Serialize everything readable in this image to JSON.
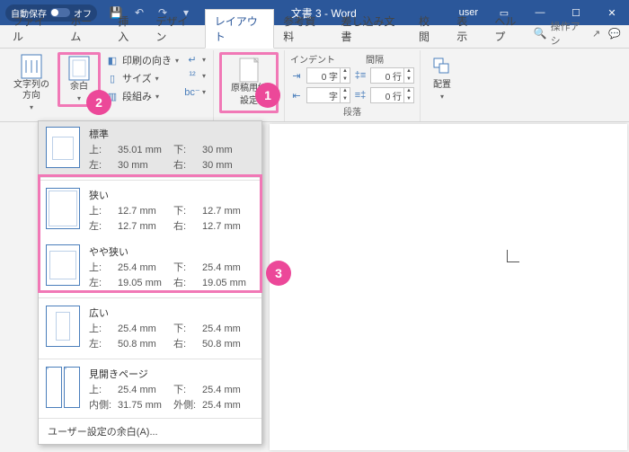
{
  "titlebar": {
    "autosave_label": "自動保存",
    "autosave_state": "オフ",
    "doc_title": "文書 3 - Word",
    "user": "user"
  },
  "tabs": {
    "items": [
      "ファイル",
      "ホーム",
      "挿入",
      "デザイン",
      "レイアウト",
      "参考資料",
      "差し込み文書",
      "校閲",
      "表示",
      "ヘルプ"
    ],
    "active_index": 4,
    "search_label": "操作アシ"
  },
  "ribbon": {
    "text_direction": {
      "label": "文字列の\n方向"
    },
    "margins": {
      "label": "余白"
    },
    "page_setup": {
      "orientation": "印刷の向き",
      "size": "サイズ",
      "columns": "段組み"
    },
    "breaks_group": {
      "items": [
        "区切り",
        "行番号",
        "ハイフネーション"
      ]
    },
    "genko": {
      "line1": "原稿用紙",
      "line2": "設定"
    },
    "indent": {
      "header_left": "インデント",
      "header_right": "間隔",
      "left_val": "0 字",
      "right_val": "0 行",
      "left_val2": "字",
      "right_val2": "0 行",
      "group_label": "段落"
    },
    "arrange": {
      "label": "配置"
    }
  },
  "callouts": {
    "c1": "1",
    "c2": "2",
    "c3": "3"
  },
  "dropdown": {
    "items": [
      {
        "title": "標準",
        "top": "35.01 mm",
        "bottom": "30 mm",
        "left": "30 mm",
        "right": "30 mm",
        "icon": "normal"
      },
      {
        "title": "狭い",
        "top": "12.7 mm",
        "bottom": "12.7 mm",
        "left": "12.7 mm",
        "right": "12.7 mm",
        "icon": "narrow"
      },
      {
        "title": "やや狭い",
        "top": "25.4 mm",
        "bottom": "25.4 mm",
        "left": "19.05 mm",
        "right": "19.05 mm",
        "icon": "moderate"
      },
      {
        "title": "広い",
        "top": "25.4 mm",
        "bottom": "25.4 mm",
        "left": "50.8 mm",
        "right": "50.8 mm",
        "icon": "wide"
      },
      {
        "title": "見開きページ",
        "top": "25.4 mm",
        "bottom": "25.4 mm",
        "left": "31.75 mm",
        "right": "25.4 mm",
        "icon": "mirror",
        "k3": "内側:",
        "k4": "外側:"
      }
    ],
    "labels": {
      "top": "上:",
      "bottom": "下:",
      "left": "左:",
      "right": "右:"
    },
    "footer": "ユーザー設定の余白(A)..."
  }
}
